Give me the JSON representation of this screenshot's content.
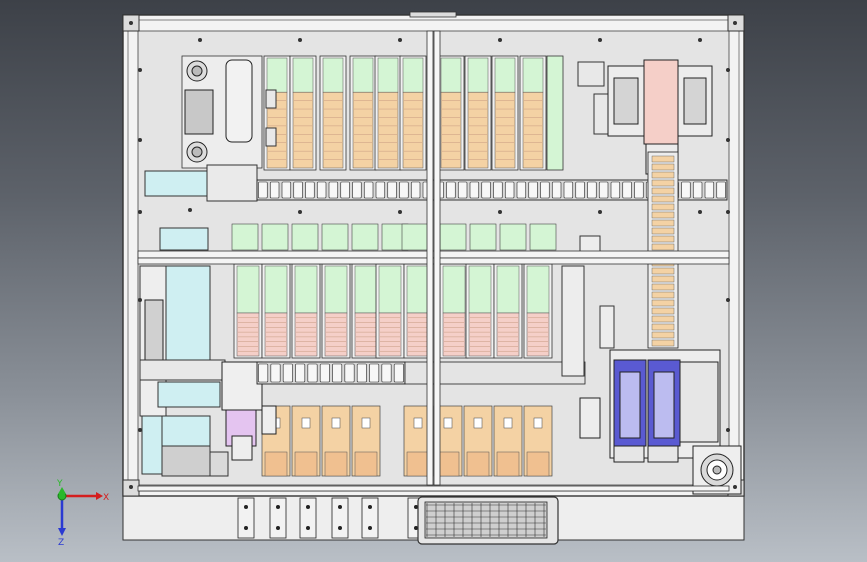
{
  "viewport": {
    "background_top": "#3d4148",
    "background_bottom": "#b9bfc6"
  },
  "colors": {
    "frame": "#f4f4f4",
    "frame_stroke": "#333333",
    "plate": "#e2e2e2",
    "tray_green": "#d4f5d4",
    "tray_orange": "#f4d2a4",
    "tray_pink": "#f5cfc8",
    "chain": "#d8d8d8",
    "cyan_block": "#cfeff2",
    "blue_cylinder": "#5a5ad2",
    "axis_x": "#d41e1e",
    "axis_y": "#2ab82a",
    "axis_z": "#2a3ad2"
  },
  "machine": {
    "upper_tray_count": 12,
    "lower_tray_count": 12,
    "bottom_tray_count": 10,
    "blue_cylinder_count": 2
  },
  "triad": {
    "x_label": "X",
    "y_label": "Y",
    "z_label": "Z"
  }
}
